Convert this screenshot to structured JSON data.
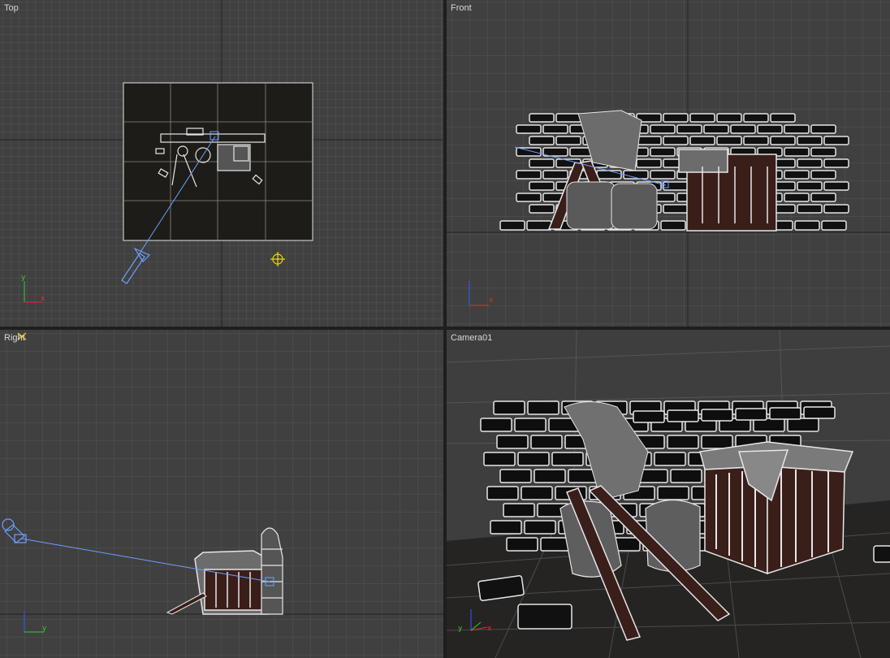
{
  "viewports": {
    "top": {
      "label": "Top"
    },
    "front": {
      "label": "Front"
    },
    "right": {
      "label": "Right"
    },
    "camera": {
      "label": "Camera01"
    }
  },
  "colors": {
    "grid_minor": "#4b4b4b",
    "grid_major": "#2a2a2a",
    "wireframe": "#e6e6e6",
    "camera_line": "#6aa0ff",
    "light_icon": "#f2d600",
    "axis_x": "#e03030",
    "axis_y": "#30d030",
    "axis_z": "#3060ff"
  },
  "axis_tripod": {
    "x": "x",
    "y": "y",
    "z": "z"
  }
}
